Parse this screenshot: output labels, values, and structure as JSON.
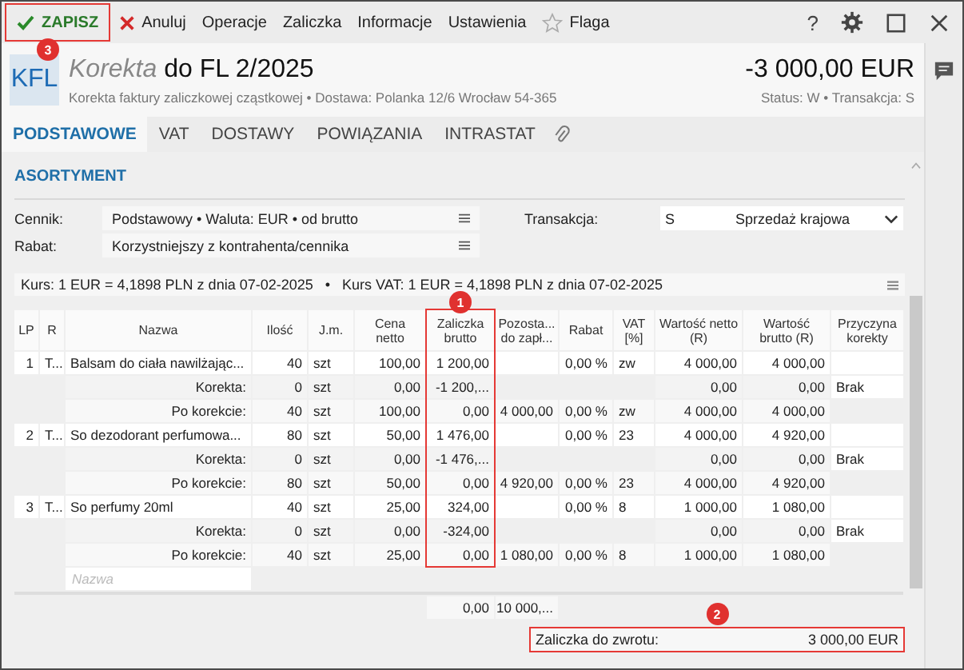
{
  "toolbar": {
    "save": {
      "label": "ZAPISZ",
      "highlighted": true,
      "badge": "3"
    },
    "items": [
      {
        "kind": "cancel",
        "label": "Anuluj"
      },
      {
        "kind": "text",
        "label": "Operacje"
      },
      {
        "kind": "text",
        "label": "Zaliczka"
      },
      {
        "kind": "text",
        "label": "Informacje"
      },
      {
        "kind": "text",
        "label": "Ustawienia"
      },
      {
        "kind": "flag",
        "label": "Flaga"
      }
    ],
    "right": [
      {
        "kind": "help",
        "label": "?"
      },
      {
        "kind": "settings"
      },
      {
        "kind": "maximize"
      },
      {
        "kind": "close"
      }
    ]
  },
  "header": {
    "badge": "KFL",
    "title_prefix": "Korekta",
    "title": "do FL 2/2025",
    "subtitle": "Korekta faktury zaliczkowej cząstkowej  •  Dostawa: Polanka  12/6  Wrocław 54-365",
    "amount": "-3 000,00 EUR",
    "status": "Status:  W  •  Transakcja:  S"
  },
  "tabs": [
    {
      "label": "PODSTAWOWE",
      "selected": true
    },
    {
      "label": "VAT",
      "selected": false
    },
    {
      "label": "DOSTAWY",
      "selected": false
    },
    {
      "label": "POWIĄZANIA",
      "selected": false
    },
    {
      "label": "INTRASTAT",
      "selected": false
    }
  ],
  "section": {
    "title": "ASORTYMENT"
  },
  "form": {
    "price_list": {
      "label": "Cennik:",
      "value": "Podstawowy • Waluta: EUR • od brutto"
    },
    "discount": {
      "label": "Rabat:",
      "value": "Korzystniejszy z kontrahenta/cennika"
    },
    "transaction": {
      "label": "Transakcja:",
      "code": "S",
      "value": "Sprzedaż krajowa"
    }
  },
  "rate": "Kurs: 1 EUR = 4,1898 PLN z dnia 07-02-2025   •   Kurs VAT: 1 EUR = 4,1898 PLN z dnia 07-02-2025",
  "table": {
    "columns": [
      {
        "label": "LP",
        "highlighted": false
      },
      {
        "label": "R",
        "highlighted": false
      },
      {
        "label": "Nazwa",
        "highlighted": false
      },
      {
        "label": "Ilość",
        "highlighted": false
      },
      {
        "label": "J.m.",
        "highlighted": false
      },
      {
        "label": "Cena\nnetto",
        "highlighted": false
      },
      {
        "label": "Zaliczka\nbrutto",
        "highlighted": true,
        "badge": "1"
      },
      {
        "label": "Pozosta...\ndo zapł...",
        "highlighted": false
      },
      {
        "label": "Rabat",
        "highlighted": false
      },
      {
        "label": "VAT\n[%]",
        "highlighted": false
      },
      {
        "label": "Wartość netto\n(R)",
        "highlighted": false
      },
      {
        "label": "Wartość\nbrutto (R)",
        "highlighted": false
      },
      {
        "label": "Przyczyna\nkorekty",
        "highlighted": false
      }
    ],
    "rows": [
      {
        "kind": "item",
        "cells": [
          "1",
          "T...",
          "Balsam do ciała nawilżając...",
          "40",
          "szt",
          "100,00",
          "1 200,00",
          "",
          "0,00 %",
          "zw",
          "4 000,00",
          "4 000,00",
          ""
        ]
      },
      {
        "kind": "correction",
        "cells": [
          "",
          "",
          "Korekta:",
          "0",
          "szt",
          "0,00",
          "-1 200,...",
          "",
          "",
          "",
          "0,00",
          "0,00",
          "Brak"
        ]
      },
      {
        "kind": "after",
        "cells": [
          "",
          "",
          "Po korekcie:",
          "40",
          "szt",
          "100,00",
          "0,00",
          "4 000,00",
          "0,00 %",
          "zw",
          "4 000,00",
          "4 000,00",
          ""
        ]
      },
      {
        "kind": "item",
        "cells": [
          "2",
          "T...",
          "So dezodorant perfumowa...",
          "80",
          "szt",
          "50,00",
          "1 476,00",
          "",
          "0,00 %",
          "23",
          "4 000,00",
          "4 920,00",
          ""
        ]
      },
      {
        "kind": "correction",
        "cells": [
          "",
          "",
          "Korekta:",
          "0",
          "szt",
          "0,00",
          "-1 476,...",
          "",
          "",
          "",
          "0,00",
          "0,00",
          "Brak"
        ]
      },
      {
        "kind": "after",
        "cells": [
          "",
          "",
          "Po korekcie:",
          "80",
          "szt",
          "50,00",
          "0,00",
          "4 920,00",
          "0,00 %",
          "23",
          "4 000,00",
          "4 920,00",
          ""
        ]
      },
      {
        "kind": "item",
        "cells": [
          "3",
          "T...",
          "So perfumy 20ml",
          "40",
          "szt",
          "25,00",
          "324,00",
          "",
          "0,00 %",
          "8",
          "1 000,00",
          "1 080,00",
          ""
        ]
      },
      {
        "kind": "correction",
        "cells": [
          "",
          "",
          "Korekta:",
          "0",
          "szt",
          "0,00",
          "-324,00",
          "",
          "",
          "",
          "0,00",
          "0,00",
          "Brak"
        ]
      },
      {
        "kind": "after",
        "cells": [
          "",
          "",
          "Po korekcie:",
          "40",
          "szt",
          "25,00",
          "0,00",
          "1 080,00",
          "0,00 %",
          "8",
          "1 000,00",
          "1 080,00",
          ""
        ]
      }
    ],
    "new_row": {
      "placeholder": "Nazwa"
    },
    "totals": {
      "advance": "0,00",
      "remaining": "10 000,..."
    }
  },
  "refund": {
    "label": "Zaliczka do zwrotu:",
    "value": "3 000,00 EUR",
    "highlighted": true,
    "badge": "2"
  }
}
